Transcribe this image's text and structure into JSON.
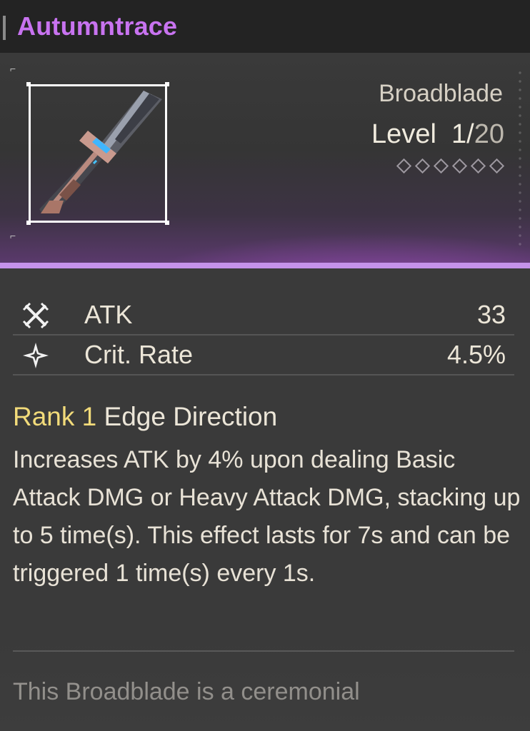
{
  "header": {
    "title": "Autumntrace"
  },
  "weapon": {
    "type": "Broadblade",
    "level_label": "Level",
    "level_current": "1/",
    "level_max": "20",
    "rank_diamond_count": 6
  },
  "stats": [
    {
      "icon": "crossed-swords-icon",
      "label": "ATK",
      "value": "33"
    },
    {
      "icon": "star-burst-icon",
      "label": "Crit. Rate",
      "value": "4.5%"
    }
  ],
  "passive": {
    "rank": "Rank 1",
    "name": "Edge Direction",
    "description": "Increases ATK by 4% upon dealing Basic Attack DMG or Heavy Attack DMG, stacking up to 5 time(s). This effect lasts for 7s and can be triggered 1 time(s) every 1s."
  },
  "lore": {
    "text": "This Broadblade is a ceremonial"
  },
  "colors": {
    "title": "#c873f0",
    "rank": "#f2db7a",
    "banner_stripe": "#c592ea"
  }
}
